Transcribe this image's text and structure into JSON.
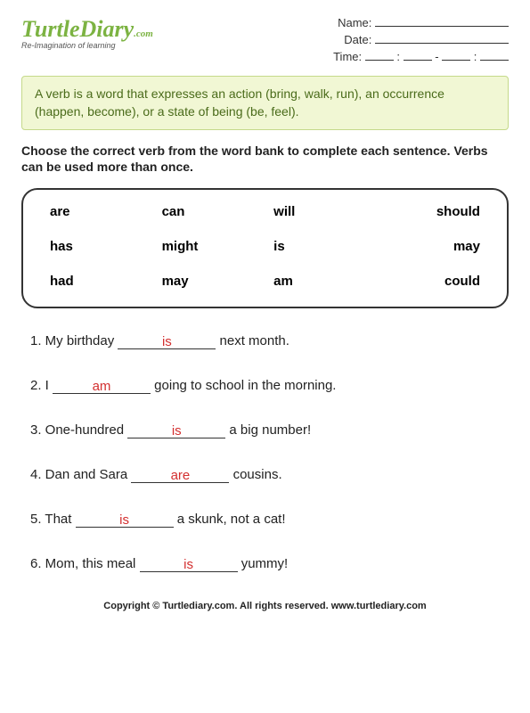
{
  "logo": {
    "brand": "TurtleDiary",
    "suffix": ".com",
    "tagline": "Re-Imagination of learning"
  },
  "meta": {
    "name_label": "Name:",
    "date_label": "Date:",
    "time_label": "Time:"
  },
  "definition": "A verb is a word that expresses an action (bring, walk, run), an occurrence (happen, become), or a state of being (be, feel).",
  "instructions": "Choose the correct verb from the word bank to complete each sentence. Verbs can be used more than once.",
  "word_bank": [
    [
      "are",
      "can",
      "will",
      "should"
    ],
    [
      "has",
      "might",
      "is",
      "may"
    ],
    [
      "had",
      "may",
      "am",
      "could"
    ]
  ],
  "questions": [
    {
      "n": "1.",
      "pre": "My birthday ",
      "ans": "is",
      "post": " next month."
    },
    {
      "n": "2.",
      "pre": "I ",
      "ans": "am",
      "post": " going to school in the morning."
    },
    {
      "n": "3.",
      "pre": "One-hundred ",
      "ans": "is",
      "post": " a big number!"
    },
    {
      "n": "4.",
      "pre": "Dan and Sara ",
      "ans": "are",
      "post": " cousins."
    },
    {
      "n": "5.",
      "pre": "That ",
      "ans": "is",
      "post": " a skunk, not a cat!"
    },
    {
      "n": "6.",
      "pre": "Mom, this meal ",
      "ans": "is",
      "post": " yummy!"
    }
  ],
  "footer": "Copyright © Turtlediary.com. All rights reserved. www.turtlediary.com"
}
